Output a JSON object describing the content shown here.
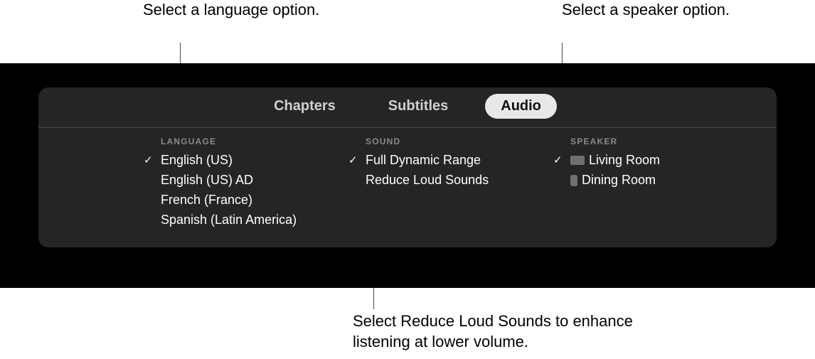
{
  "callouts": {
    "language": "Select a language option.",
    "speaker": "Select a speaker option.",
    "sound": "Select Reduce Loud Sounds to enhance listening at lower volume."
  },
  "tabs": {
    "chapters": "Chapters",
    "subtitles": "Subtitles",
    "audio": "Audio"
  },
  "columns": {
    "language": {
      "header": "LANGUAGE",
      "items": [
        "English (US)",
        "English (US) AD",
        "French (France)",
        "Spanish (Latin America)"
      ]
    },
    "sound": {
      "header": "SOUND",
      "items": [
        "Full Dynamic Range",
        "Reduce Loud Sounds"
      ]
    },
    "speaker": {
      "header": "SPEAKER",
      "items": [
        "Living Room",
        "Dining Room"
      ]
    }
  }
}
